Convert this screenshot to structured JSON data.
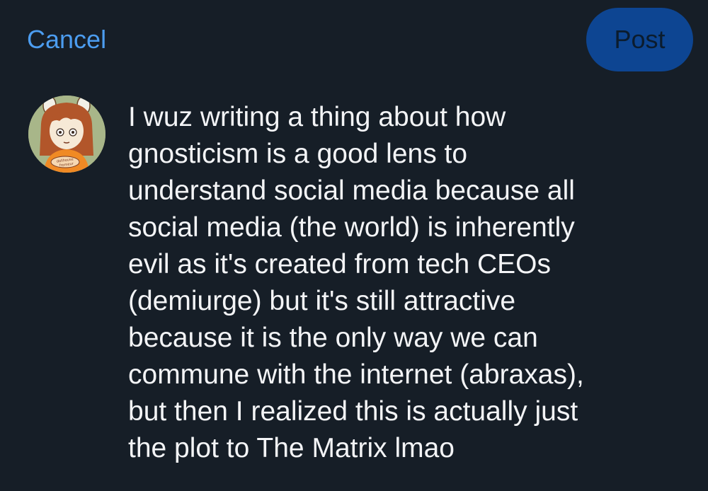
{
  "header": {
    "cancel_label": "Cancel",
    "post_label": "Post"
  },
  "avatar": {
    "icon": "user-avatar-illustration",
    "badge_text": "dollhouse fromeur"
  },
  "composer": {
    "lines": [
      "I wuz writing a thing about how",
      "gnosticism is a good lens to",
      "understand social media because all",
      "social media (the world) is inherently",
      "evil as it's created from tech CEOs",
      "(demiurge) but it's still attractive",
      "because it is the only way we can",
      "commune with the internet (abraxas),",
      "but then I realized this is actually just",
      "the plot to The Matrix lmao"
    ]
  },
  "colors": {
    "background": "#161e27",
    "accent": "#4c9df0",
    "post_button": "#0d4592",
    "text": "#f3f4f6"
  }
}
